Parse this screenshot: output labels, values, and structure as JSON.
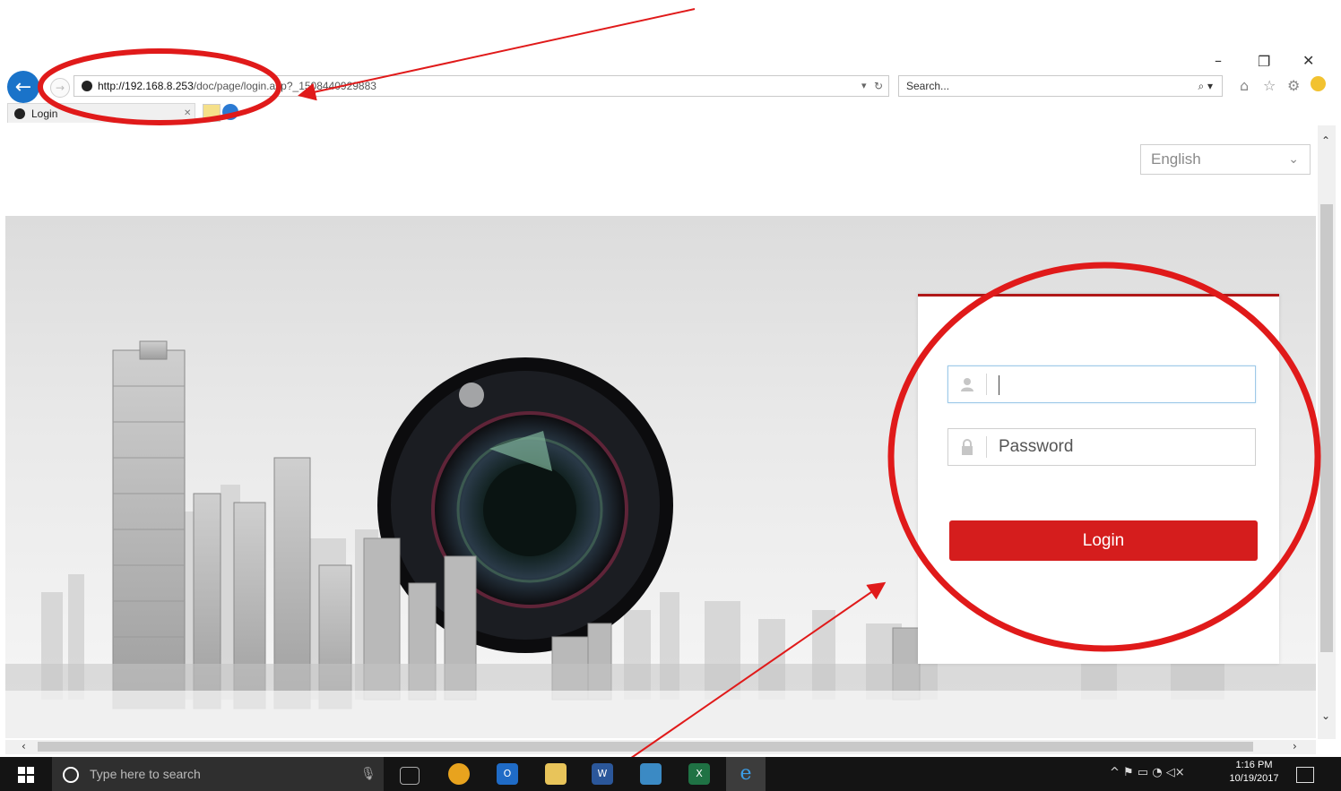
{
  "browser": {
    "address_host": "http://192.168.8.253",
    "address_rest": "/doc/page/login.asp?_1508440929883",
    "search_placeholder": "Search...",
    "tab_title": "Login",
    "win_minimize": "–",
    "win_restore": "❐",
    "win_close": "✕"
  },
  "page": {
    "language_selected": "English",
    "login": {
      "password_placeholder": "Password",
      "button_label": "Login"
    }
  },
  "taskbar": {
    "search_placeholder": "Type here to search",
    "time": "1:16 PM",
    "date": "10/19/2017"
  },
  "annotation_color": "#e01a1a",
  "icons": {
    "back": "back-arrow-icon",
    "forward": "forward-arrow-icon",
    "home": "home-icon",
    "favorites": "star-icon",
    "settings": "gear-icon",
    "user": "user-icon",
    "lock": "lock-icon"
  }
}
